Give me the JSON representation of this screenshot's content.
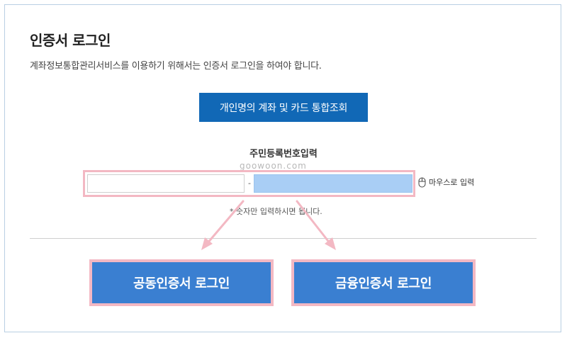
{
  "page": {
    "title": "인증서 로그인",
    "description": "계좌정보통합관리서비스를 이용하기 위해서는 인증서 로그인을 하여야 합니다."
  },
  "lookup_button": {
    "label": "개인명의 계좌 및 카드 통합조회"
  },
  "id_input": {
    "label": "주민등록번호입력",
    "front_value": "",
    "separator": "-",
    "back_value": "",
    "mouse_input_label": "마우스로 입력",
    "note": "* 숫자만 입력하시면 됩니다."
  },
  "watermark": "goowoon.com",
  "login_buttons": {
    "joint_certificate": "공동인증서 로그인",
    "financial_certificate": "금융인증서 로그인"
  },
  "colors": {
    "primary_button": "#1168b6",
    "login_button": "#3a7fd1",
    "highlight_border": "#f3b8c3",
    "secure_field": "#a9cef5",
    "frame_border": "#b9cfe3"
  },
  "icons": {
    "mouse": "mouse-icon",
    "arrow_left": "arrow-down-left-icon",
    "arrow_right": "arrow-down-right-icon"
  }
}
